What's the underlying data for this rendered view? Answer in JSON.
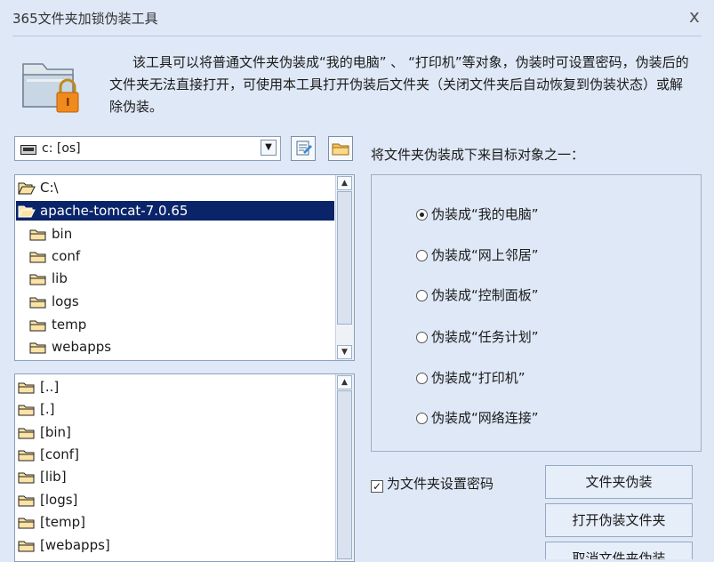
{
  "window": {
    "title": "365文件夹加锁伪装工具",
    "close": "x"
  },
  "description": "该工具可以将普通文件夹伪装成“我的电脑” 、 “打印机”等对象，伪装时可设置密码，伪装后的文件夹无法直接打开，可使用本工具打开伪装后文件夹（关闭文件夹后自动恢复到伪装状态）或解除伪装。",
  "drive": {
    "label": "c: [os]"
  },
  "folder_tree": [
    {
      "label": "C:\\",
      "open": true
    },
    {
      "label": "apache-tomcat-7.0.65",
      "open": true,
      "selected": true
    },
    {
      "label": "bin"
    },
    {
      "label": "conf"
    },
    {
      "label": "lib"
    },
    {
      "label": "logs"
    },
    {
      "label": "temp"
    },
    {
      "label": "webapps"
    }
  ],
  "file_list": [
    "[..]",
    "[.]",
    "[bin]",
    "[conf]",
    "[lib]",
    "[logs]",
    "[temp]",
    "[webapps]"
  ],
  "target_label": "将文件夹伪装成下来目标对象之一：",
  "options": [
    {
      "label": "伪装成“我的电脑”",
      "checked": true
    },
    {
      "label": "伪装成“网上邻居”",
      "checked": false
    },
    {
      "label": "伪装成“控制面板”",
      "checked": false
    },
    {
      "label": "伪装成“任务计划”",
      "checked": false
    },
    {
      "label": "伪装成“打印机”",
      "checked": false
    },
    {
      "label": "伪装成“网络连接”",
      "checked": false
    }
  ],
  "password_checkbox": {
    "label": "为文件夹设置密码",
    "checked": true
  },
  "buttons": {
    "disguise": "文件夹伪装",
    "open": "打开伪装文件夹",
    "remove": "取消文件夹伪装"
  },
  "colors": {
    "background": "#dfe8f6",
    "selection": "#0a246a",
    "folder": "#f6c35d"
  }
}
